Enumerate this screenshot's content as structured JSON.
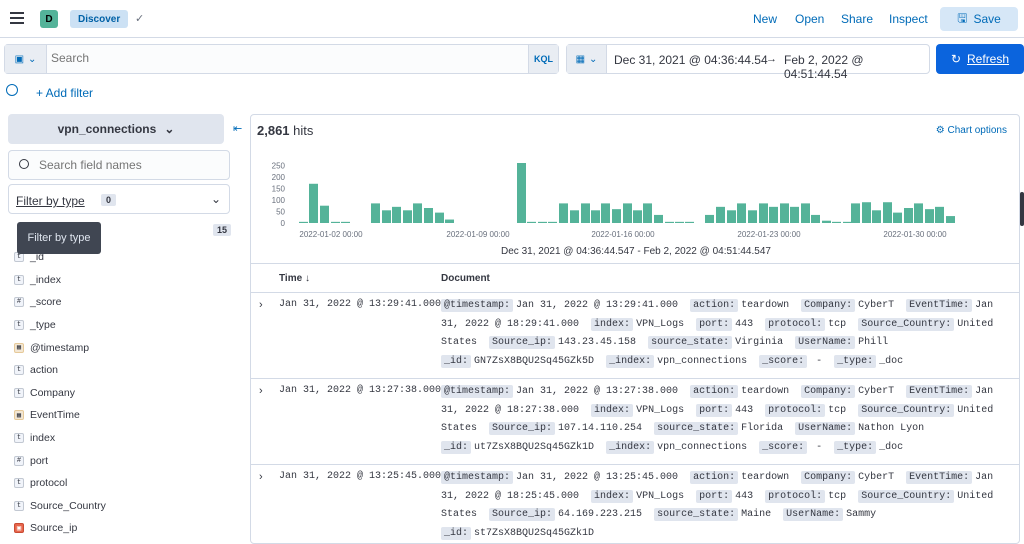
{
  "header": {
    "space_initial": "D",
    "app_name": "Discover",
    "links": [
      "New",
      "Open",
      "Share",
      "Inspect"
    ],
    "save_label": "Save"
  },
  "query": {
    "placeholder": "Search",
    "language": "KQL"
  },
  "time": {
    "start": "Dec 31, 2021 @ 04:36:44.54",
    "arrow": "→",
    "end": "Feb 2, 2022 @ 04:51:44.54",
    "refresh_label": "Refresh"
  },
  "filters": {
    "add_label": "+ Add filter"
  },
  "sidebar": {
    "index_pattern": "vpn_connections",
    "search_placeholder": "Search field names",
    "filter_by_type_label": "Filter by type",
    "filter_count": "0",
    "tooltip": "Filter by type",
    "available_count": "15",
    "fields": [
      {
        "type": "t",
        "name": "_id",
        "kind": "string"
      },
      {
        "type": "t",
        "name": "_index",
        "kind": "string"
      },
      {
        "type": "#",
        "name": "_score",
        "kind": "number"
      },
      {
        "type": "t",
        "name": "_type",
        "kind": "string"
      },
      {
        "type": "▦",
        "name": "@timestamp",
        "kind": "date"
      },
      {
        "type": "t",
        "name": "action",
        "kind": "string"
      },
      {
        "type": "t",
        "name": "Company",
        "kind": "string"
      },
      {
        "type": "▦",
        "name": "EventTime",
        "kind": "date"
      },
      {
        "type": "t",
        "name": "index",
        "kind": "string"
      },
      {
        "type": "#",
        "name": "port",
        "kind": "number"
      },
      {
        "type": "t",
        "name": "protocol",
        "kind": "string"
      },
      {
        "type": "t",
        "name": "Source_Country",
        "kind": "string"
      },
      {
        "type": "▣",
        "name": "Source_ip",
        "kind": "ip"
      }
    ]
  },
  "results": {
    "hits_count": "2,861",
    "hits_label": "hits",
    "chart_options_label": "Chart options",
    "histogram_caption": "Dec 31, 2021 @ 04:36:44.547 - Feb 2, 2022 @ 04:51:44.547",
    "col_time": "Time ↓",
    "col_document": "Document",
    "rows": [
      {
        "time": "Jan 31, 2022 @ 13:29:41.000",
        "fields": [
          [
            "@timestamp:",
            "Jan 31, 2022 @ 13:29:41.000"
          ],
          [
            "action:",
            "teardown"
          ],
          [
            "Company:",
            "CyberT"
          ],
          [
            "EventTime:",
            "Jan 31, 2022 @ 18:29:41.000"
          ],
          [
            "index:",
            "VPN_Logs"
          ],
          [
            "port:",
            "443"
          ],
          [
            "protocol:",
            "tcp"
          ],
          [
            "Source_Country:",
            "United States"
          ],
          [
            "Source_ip:",
            "143.23.45.158"
          ],
          [
            "source_state:",
            "Virginia"
          ],
          [
            "UserName:",
            "Phill"
          ],
          [
            "_id:",
            "GN7ZsX8BQU2Sq45GZk5D"
          ],
          [
            "_index:",
            "vpn_connections"
          ],
          [
            "_score:",
            " - "
          ],
          [
            "_type:",
            "_doc"
          ]
        ]
      },
      {
        "time": "Jan 31, 2022 @ 13:27:38.000",
        "fields": [
          [
            "@timestamp:",
            "Jan 31, 2022 @ 13:27:38.000"
          ],
          [
            "action:",
            "teardown"
          ],
          [
            "Company:",
            "CyberT"
          ],
          [
            "EventTime:",
            "Jan 31, 2022 @ 18:27:38.000"
          ],
          [
            "index:",
            "VPN_Logs"
          ],
          [
            "port:",
            "443"
          ],
          [
            "protocol:",
            "tcp"
          ],
          [
            "Source_Country:",
            "United States"
          ],
          [
            "Source_ip:",
            "107.14.110.254"
          ],
          [
            "source_state:",
            "Florida"
          ],
          [
            "UserName:",
            "Nathon Lyon"
          ],
          [
            "_id:",
            "ut7ZsX8BQU2Sq45GZk1D"
          ],
          [
            "_index:",
            "vpn_connections"
          ],
          [
            "_score:",
            " - "
          ],
          [
            "_type:",
            "_doc"
          ]
        ]
      },
      {
        "time": "Jan 31, 2022 @ 13:25:45.000",
        "fields": [
          [
            "@timestamp:",
            "Jan 31, 2022 @ 13:25:45.000"
          ],
          [
            "action:",
            "teardown"
          ],
          [
            "Company:",
            "CyberT"
          ],
          [
            "EventTime:",
            "Jan 31, 2022 @ 18:25:45.000"
          ],
          [
            "index:",
            "VPN_Logs"
          ],
          [
            "port:",
            "443"
          ],
          [
            "protocol:",
            "tcp"
          ],
          [
            "Source_Country:",
            "United States"
          ],
          [
            "Source_ip:",
            "64.169.223.215"
          ],
          [
            "source_state:",
            "Maine"
          ],
          [
            "UserName:",
            "Sammy"
          ],
          [
            "_id:",
            "st7ZsX8BQU2Sq45GZk1D"
          ]
        ]
      }
    ]
  },
  "chart_data": {
    "type": "bar",
    "color": "#54b399",
    "ylim": [
      0,
      260
    ],
    "yticks": [
      0,
      50,
      100,
      150,
      200,
      250
    ],
    "xtick_labels": [
      "2022-01-02 00:00",
      "2022-01-09 00:00",
      "2022-01-16 00:00",
      "2022-01-23 00:00",
      "2022-01-30 00:00"
    ],
    "values": [
      0,
      170,
      75,
      0,
      0,
      0,
      0,
      0,
      0,
      0,
      0,
      0,
      85,
      55,
      70,
      55,
      85,
      65,
      45,
      0,
      0,
      0,
      0,
      0,
      0,
      0,
      0,
      0,
      0,
      0,
      0,
      0,
      0,
      0,
      0,
      0,
      0,
      0,
      0,
      0,
      0,
      0,
      0,
      0,
      0,
      0,
      0,
      0,
      0,
      0,
      0,
      0,
      0,
      0,
      0,
      0,
      0,
      0,
      0,
      0,
      0,
      0,
      0,
      0,
      0,
      0,
      0,
      0,
      0,
      0,
      0,
      0,
      0,
      0,
      0,
      0,
      0,
      0,
      0,
      0,
      0,
      0,
      0,
      0,
      0,
      0,
      0,
      0,
      0,
      0,
      0,
      0,
      0,
      0,
      0,
      0,
      0,
      0,
      0,
      0,
      0,
      0,
      0,
      0,
      0,
      0,
      0,
      0,
      0,
      0,
      0,
      0,
      0,
      0,
      0,
      0,
      0,
      0,
      0,
      0,
      0,
      0,
      0,
      0,
      0,
      0,
      0,
      0,
      0,
      0,
      0,
      0,
      0
    ]
  }
}
